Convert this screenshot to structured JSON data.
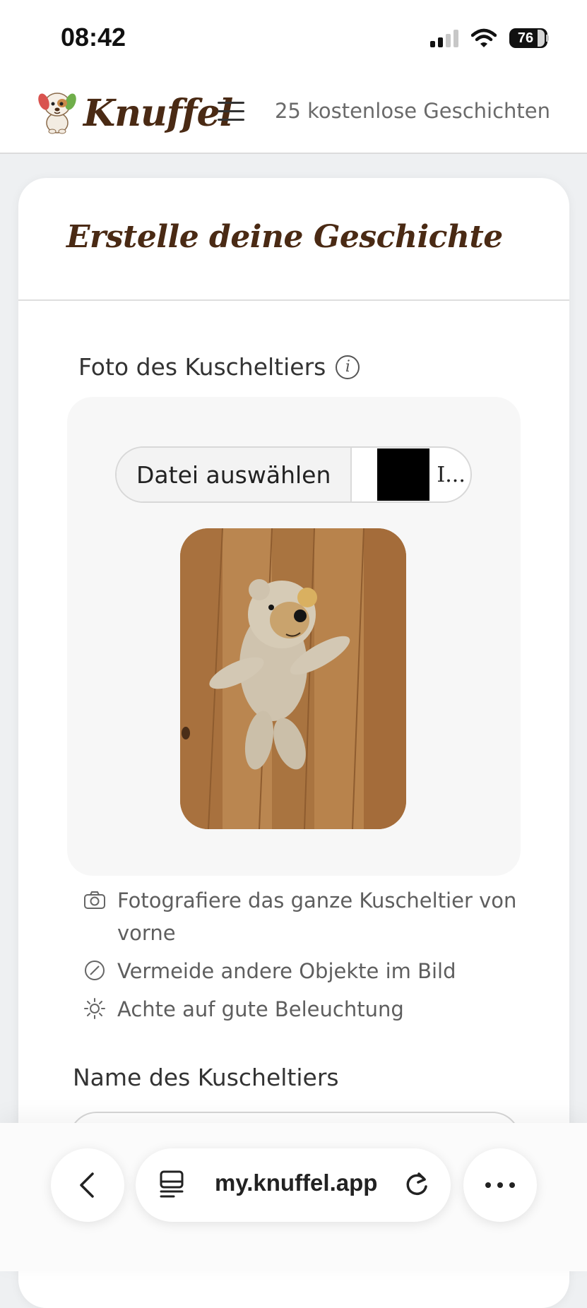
{
  "status_bar": {
    "time": "08:42",
    "battery": "76"
  },
  "header": {
    "brand": "Knuffel",
    "free_stories": "25 kostenlose Geschichten"
  },
  "card": {
    "title": "Erstelle deine Geschichte",
    "photo_label": "Foto des Kuscheltiers",
    "file_button": "Datei auswählen",
    "file_name": "I...",
    "tips": [
      {
        "icon": "camera-icon",
        "text": "Fotografiere das ganze Kuscheltier von vorne"
      },
      {
        "icon": "no-objects-icon",
        "text": "Vermeide andere Objekte im Bild"
      },
      {
        "icon": "sun-icon",
        "text": "Achte auf gute Beleuchtung"
      }
    ],
    "name_label": "Name des Kuscheltiers",
    "name_value": ""
  },
  "browser": {
    "url": "my.knuffel.app"
  },
  "colors": {
    "brand_brown": "#4a2a14",
    "muted_text": "#6a6a6a",
    "panel_bg": "#f7f7f7"
  }
}
